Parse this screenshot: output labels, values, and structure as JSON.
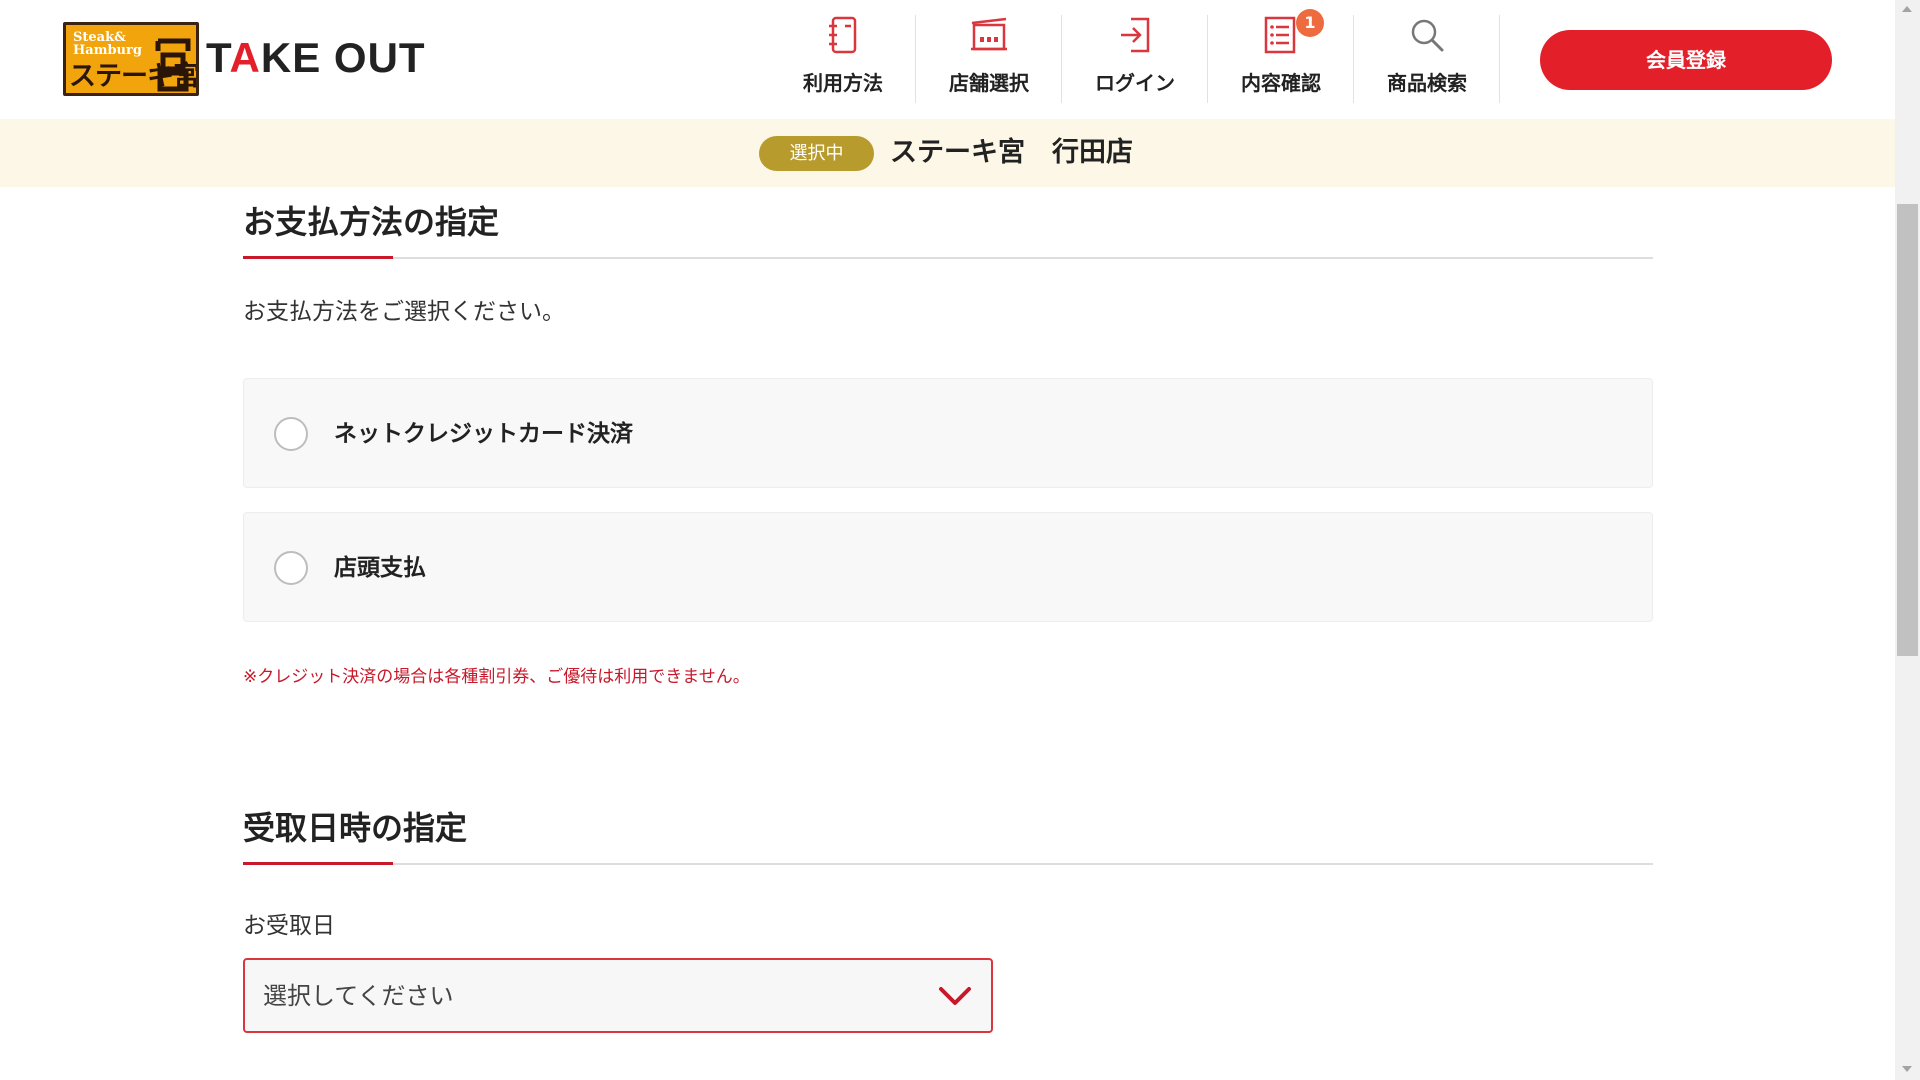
{
  "header": {
    "logo": {
      "line1": "Steak&",
      "line2": "Hamburg",
      "main": "ステーキ宮",
      "mark": "宮"
    },
    "brand_title_first": "T",
    "brand_title_accent": "A",
    "brand_title_rest": "KE OUT",
    "nav": [
      {
        "label": "利用方法",
        "icon": "guide-book-icon"
      },
      {
        "label": "店舗選択",
        "icon": "store-icon"
      },
      {
        "label": "ログイン",
        "icon": "login-icon"
      },
      {
        "label": "内容確認",
        "icon": "order-list-icon",
        "badge": "1"
      },
      {
        "label": "商品検索",
        "icon": "search-icon"
      }
    ],
    "register_label": "会員登録"
  },
  "store_bar": {
    "pill": "選択中",
    "store_name": "ステーキ宮　行田店"
  },
  "payment": {
    "title": "お支払方法の指定",
    "instruction": "お支払方法をご選択ください。",
    "options": [
      {
        "label": "ネットクレジットカード決済",
        "selected": false
      },
      {
        "label": "店頭支払",
        "selected": false
      }
    ],
    "note": "※クレジット決済の場合は各種割引券、ご優待は利用できません。"
  },
  "pickup": {
    "title": "受取日時の指定",
    "date_label": "お受取日",
    "date_select_value": "選択してください"
  },
  "colors": {
    "accent_red": "#e3202a",
    "store_bar_bg": "#fcf7e6",
    "pill_gold": "#b89b2d",
    "badge_orange": "#ee6b3f",
    "logo_orange": "#f1a40c"
  }
}
